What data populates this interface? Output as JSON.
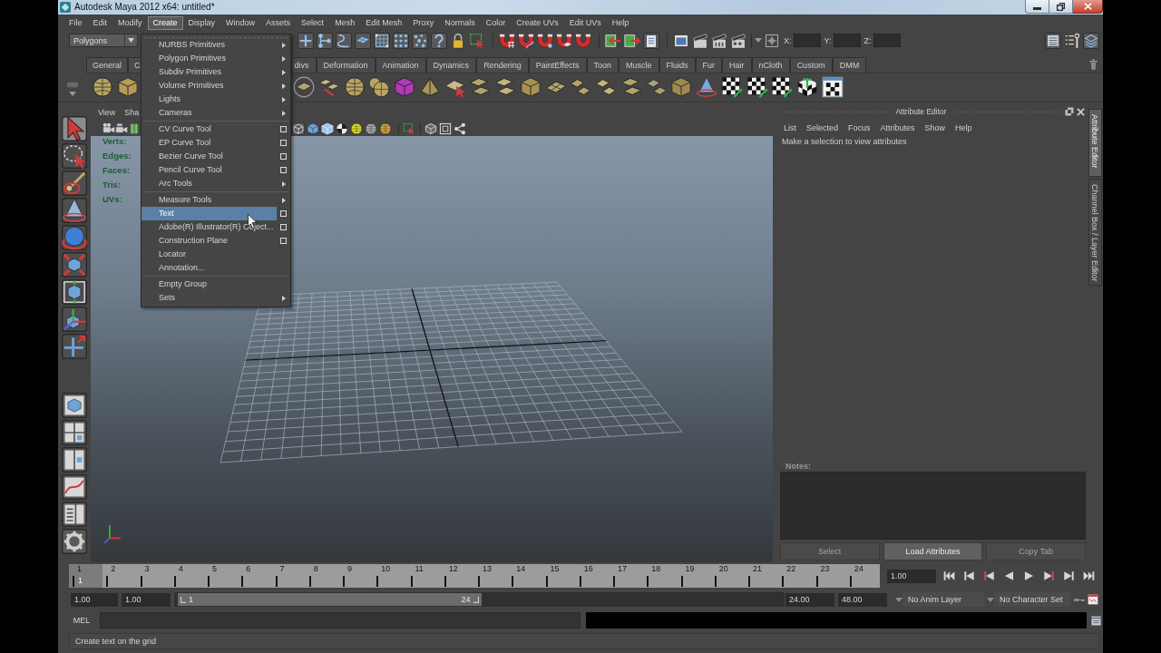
{
  "window": {
    "title": "Autodesk Maya 2012 x64: untitled*"
  },
  "menu_bar": [
    {
      "label": "File",
      "selected": false
    },
    {
      "label": "Edit",
      "selected": false
    },
    {
      "label": "Modify",
      "selected": false
    },
    {
      "label": "Create",
      "selected": true
    },
    {
      "label": "Display",
      "selected": false
    },
    {
      "label": "Window",
      "selected": false
    },
    {
      "label": "Assets",
      "selected": false
    },
    {
      "label": "Select",
      "selected": false
    },
    {
      "label": "Mesh",
      "selected": false
    },
    {
      "label": "Edit Mesh",
      "selected": false
    },
    {
      "label": "Proxy",
      "selected": false
    },
    {
      "label": "Normals",
      "selected": false
    },
    {
      "label": "Color",
      "selected": false
    },
    {
      "label": "Create UVs",
      "selected": false
    },
    {
      "label": "Edit UVs",
      "selected": false
    },
    {
      "label": "Help",
      "selected": false
    }
  ],
  "status_line": {
    "menu_set": "Polygons",
    "coordinates": [
      {
        "label": "X:"
      },
      {
        "label": "Y:"
      },
      {
        "label": "Z:"
      }
    ]
  },
  "shelf": {
    "tabs": [
      {
        "label": "General",
        "selected": false
      },
      {
        "label": "C",
        "selected": false
      },
      {
        "label": "divs",
        "selected": false
      },
      {
        "label": "Deformation",
        "selected": false
      },
      {
        "label": "Animation",
        "selected": false
      },
      {
        "label": "Dynamics",
        "selected": false
      },
      {
        "label": "Rendering",
        "selected": false
      },
      {
        "label": "PaintEffects",
        "selected": false
      },
      {
        "label": "Toon",
        "selected": false
      },
      {
        "label": "Muscle",
        "selected": false
      },
      {
        "label": "Fluids",
        "selected": false
      },
      {
        "label": "Fur",
        "selected": false
      },
      {
        "label": "Hair",
        "selected": false
      },
      {
        "label": "nCloth",
        "selected": false
      },
      {
        "label": "Custom",
        "selected": false
      },
      {
        "label": "DMM",
        "selected": false
      }
    ]
  },
  "toolbox": {
    "tools": [
      {
        "selected": true
      },
      {
        "selected": false
      },
      {
        "selected": false
      },
      {
        "selected": false
      },
      {
        "selected": false
      },
      {
        "selected": false
      },
      {
        "selected": false
      },
      {
        "selected": false
      },
      {
        "selected": false
      }
    ]
  },
  "viewport": {
    "menus": [
      {
        "label": "View"
      },
      {
        "label": "Sha"
      }
    ],
    "hud": [
      {
        "label": "Verts:"
      },
      {
        "label": "Edges:"
      },
      {
        "label": "Faces:"
      },
      {
        "label": "Tris:"
      },
      {
        "label": "UVs:"
      }
    ]
  },
  "create_menu": {
    "groups": [
      {
        "items": [
          {
            "label": "NURBS Primitives",
            "kind": "submenu",
            "highlighted": false
          },
          {
            "label": "Polygon Primitives",
            "kind": "submenu",
            "highlighted": false
          },
          {
            "label": "Subdiv Primitives",
            "kind": "submenu",
            "highlighted": false
          },
          {
            "label": "Volume Primitives",
            "kind": "submenu",
            "highlighted": false
          },
          {
            "label": "Lights",
            "kind": "submenu",
            "highlighted": false
          },
          {
            "label": "Cameras",
            "kind": "submenu",
            "highlighted": false
          }
        ]
      },
      {
        "items": [
          {
            "label": "CV Curve Tool",
            "kind": "option",
            "highlighted": false
          },
          {
            "label": "EP Curve Tool",
            "kind": "option",
            "highlighted": false
          },
          {
            "label": "Bezier Curve Tool",
            "kind": "option",
            "highlighted": false
          },
          {
            "label": "Pencil Curve Tool",
            "kind": "option",
            "highlighted": false
          },
          {
            "label": "Arc Tools",
            "kind": "submenu",
            "highlighted": false
          }
        ]
      },
      {
        "items": [
          {
            "label": "Measure Tools",
            "kind": "submenu",
            "highlighted": false
          },
          {
            "label": "Text",
            "kind": "option",
            "highlighted": true
          },
          {
            "label": "Adobe(R) Illustrator(R) Object...",
            "kind": "option",
            "highlighted": false
          },
          {
            "label": "Construction Plane",
            "kind": "option",
            "highlighted": false
          },
          {
            "label": "Locator",
            "kind": "plain",
            "highlighted": false
          },
          {
            "label": "Annotation...",
            "kind": "plain",
            "highlighted": false
          }
        ]
      },
      {
        "items": [
          {
            "label": "Empty Group",
            "kind": "plain",
            "highlighted": false
          },
          {
            "label": "Sets",
            "kind": "submenu",
            "highlighted": false
          }
        ]
      }
    ]
  },
  "attribute_editor": {
    "title": "Attribute Editor",
    "menus": [
      {
        "label": "List"
      },
      {
        "label": "Selected"
      },
      {
        "label": "Focus"
      },
      {
        "label": "Attributes"
      },
      {
        "label": "Show"
      },
      {
        "label": "Help"
      }
    ],
    "message": "Make a selection to view attributes",
    "notes_label": "Notes:",
    "buttons": [
      {
        "label": "Select",
        "disabled": true
      },
      {
        "label": "Load Attributes",
        "disabled": false
      },
      {
        "label": "Copy Tab",
        "disabled": true
      }
    ]
  },
  "side_tabs": [
    {
      "label": "Attribute Editor",
      "selected": true
    },
    {
      "label": "Channel Box / Layer Editor",
      "selected": false
    }
  ],
  "time_slider": {
    "frames": [
      {
        "label": "1",
        "current": true
      },
      {
        "label": "2",
        "current": false
      },
      {
        "label": "3",
        "current": false
      },
      {
        "label": "4",
        "current": false
      },
      {
        "label": "5",
        "current": false
      },
      {
        "label": "6",
        "current": false
      },
      {
        "label": "7",
        "current": false
      },
      {
        "label": "8",
        "current": false
      },
      {
        "label": "9",
        "current": false
      },
      {
        "label": "10",
        "current": false
      },
      {
        "label": "11",
        "current": false
      },
      {
        "label": "12",
        "current": false
      },
      {
        "label": "13",
        "current": false
      },
      {
        "label": "14",
        "current": false
      },
      {
        "label": "15",
        "current": false
      },
      {
        "label": "16",
        "current": false
      },
      {
        "label": "17",
        "current": false
      },
      {
        "label": "18",
        "current": false
      },
      {
        "label": "19",
        "current": false
      },
      {
        "label": "20",
        "current": false
      },
      {
        "label": "21",
        "current": false
      },
      {
        "label": "22",
        "current": false
      },
      {
        "label": "23",
        "current": false
      },
      {
        "label": "24",
        "current": false
      }
    ],
    "current_frame": "1",
    "current_time": "1.00"
  },
  "range_slider": {
    "start_time": "1.00",
    "playback_start": "1.00",
    "range_start": "1",
    "range_end": "24",
    "level": 0.5,
    "playback_end": "24.00",
    "end_time": "48.00",
    "anim_layer": "No Anim Layer",
    "character_set": "No Character Set"
  },
  "command_line": {
    "label": "MEL"
  },
  "help_line": {
    "text": "Create text on the grid"
  }
}
